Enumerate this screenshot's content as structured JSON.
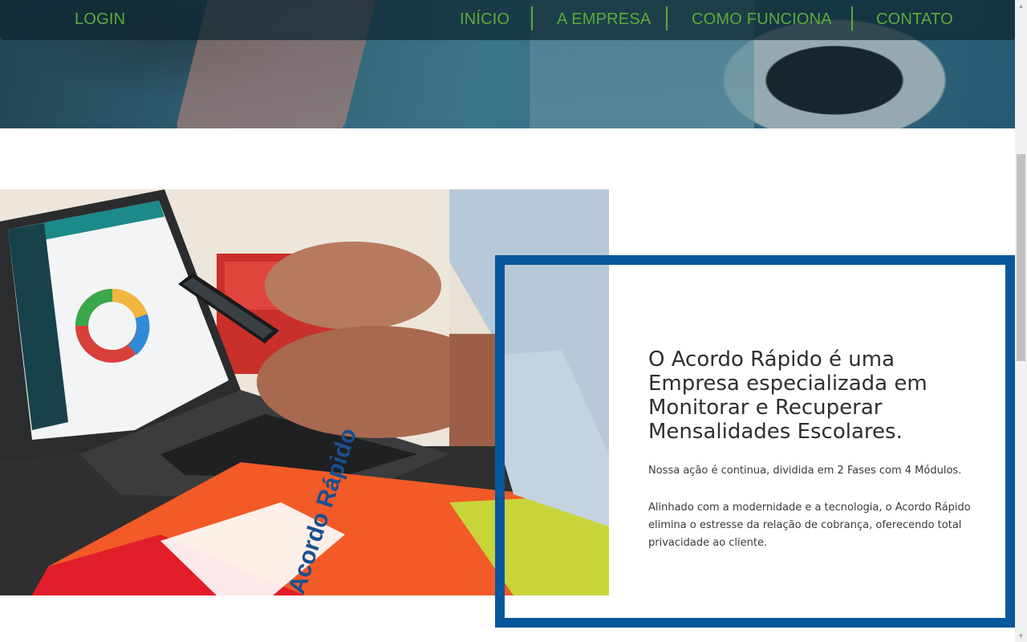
{
  "nav": {
    "login": "LOGIN",
    "items": [
      {
        "label": "INÍCIO"
      },
      {
        "label": "A EMPRESA"
      },
      {
        "label": "COMO FUNCIONA"
      },
      {
        "label": "CONTATO"
      }
    ]
  },
  "about": {
    "title": "O Acordo Rápido é uma Empresa especializada em Monitorar e Recuperar Mensalidades Escolares.",
    "paragraph1": "Nossa ação é continua, dividida em 2 Fases com 4 Módulos.",
    "paragraph2": "Alinhado com a modernidade e a tecnologia, o Acordo Rápido elimina o estresse da relação de cobrança, oferecendo total privacidade ao cliente.",
    "folder_brand": "Acordo Rápido"
  },
  "colors": {
    "nav_accent": "#5cab3b",
    "card_border": "#07579d"
  },
  "icons": {
    "scroll_up": "triangle-up",
    "scroll_down": "triangle-down"
  }
}
